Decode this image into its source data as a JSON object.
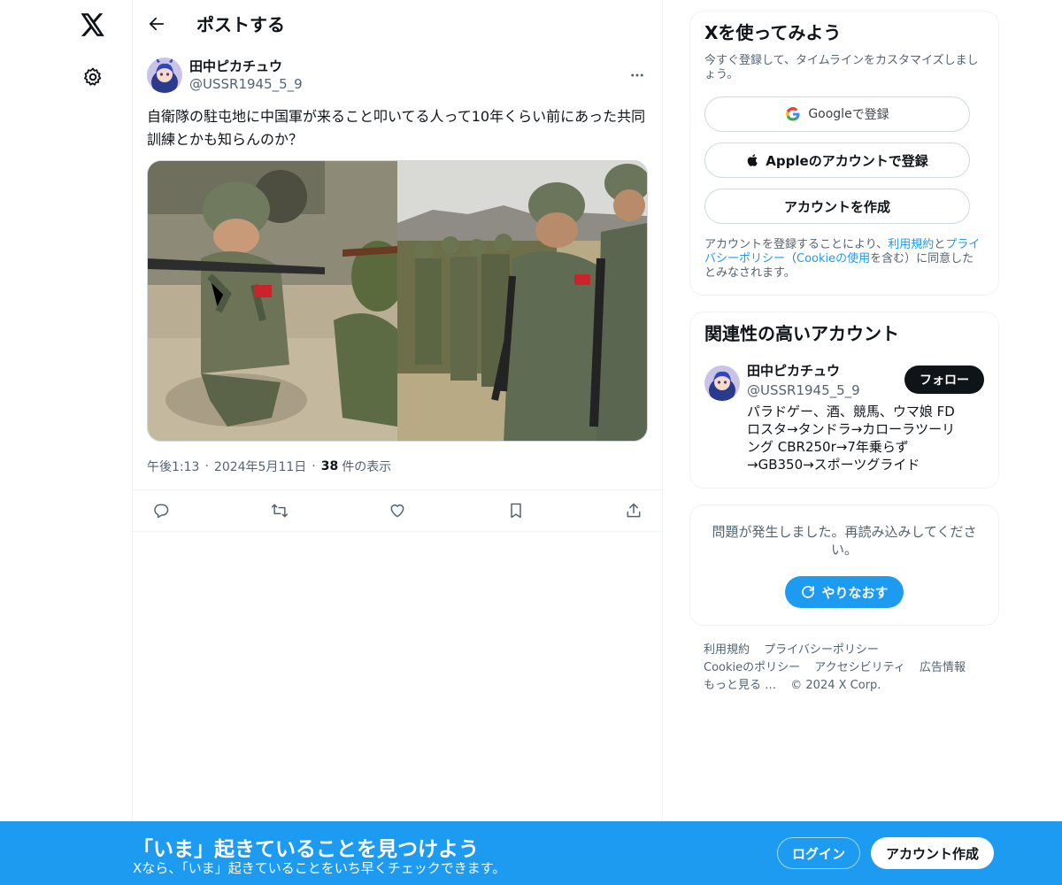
{
  "nav": {
    "logo_icon": "x-logo-icon",
    "settings_icon": "gear-icon"
  },
  "header": {
    "title": "ポストする"
  },
  "post": {
    "author_name": "田中ピカチュウ",
    "author_handle": "@USSR1945_5_9",
    "text": "自衛隊の駐屯地に中国軍が来ること叩いてる人って10年くらい前にあった共同訓練とかも知らんのか？",
    "time": "午後1:13",
    "date": "2024年5月11日",
    "views_count": "38",
    "views_label": "件の表示",
    "dot": "·"
  },
  "signup_card": {
    "title": "Xを使ってみよう",
    "subtitle": "今すぐ登録して、タイムラインをカスタマイズしましょう。",
    "google_label": "Google",
    "google_suffix": " で登録",
    "apple_label": "Appleのアカウントで登録",
    "create_label": "アカウントを作成",
    "legal_1": "アカウントを登録することにより、",
    "legal_terms": "利用規約",
    "legal_2": "と",
    "legal_privacy": "プライバシーポリシー",
    "legal_3": "（",
    "legal_cookie": "Cookieの使用",
    "legal_4": "を含む）に同意したとみなされます。"
  },
  "related": {
    "title": "関連性の高いアカウント",
    "name": "田中ピカチュウ",
    "handle": "@USSR1945_5_9",
    "follow_label": "フォロー",
    "bio": "パラドゲー、酒、競馬、ウマ娘 FDロスタ→タンドラ→カローラツーリング CBR250r→7年乗らず→GB350→スポーツグライド"
  },
  "error_card": {
    "text": "問題が発生しました。再読み込みしてください。",
    "retry_label": "やりなおす"
  },
  "footer": {
    "terms": "利用規約",
    "privacy": "プライバシーポリシー",
    "cookie": "Cookieのポリシー",
    "accessibility": "アクセシビリティ",
    "ads": "広告情報",
    "more": "もっと見る …",
    "copyright": "© 2024 X Corp."
  },
  "bottom_bar": {
    "title": "「いま」起きていることを見つけよう",
    "subtitle": "Xなら、「いま」起きていることをいち早くチェックできます。",
    "login_label": "ログイン",
    "signup_label": "アカウント作成"
  },
  "colors": {
    "accent": "#1d9bf0",
    "text": "#0f1419",
    "muted": "#536471",
    "border": "#eff3f4"
  }
}
